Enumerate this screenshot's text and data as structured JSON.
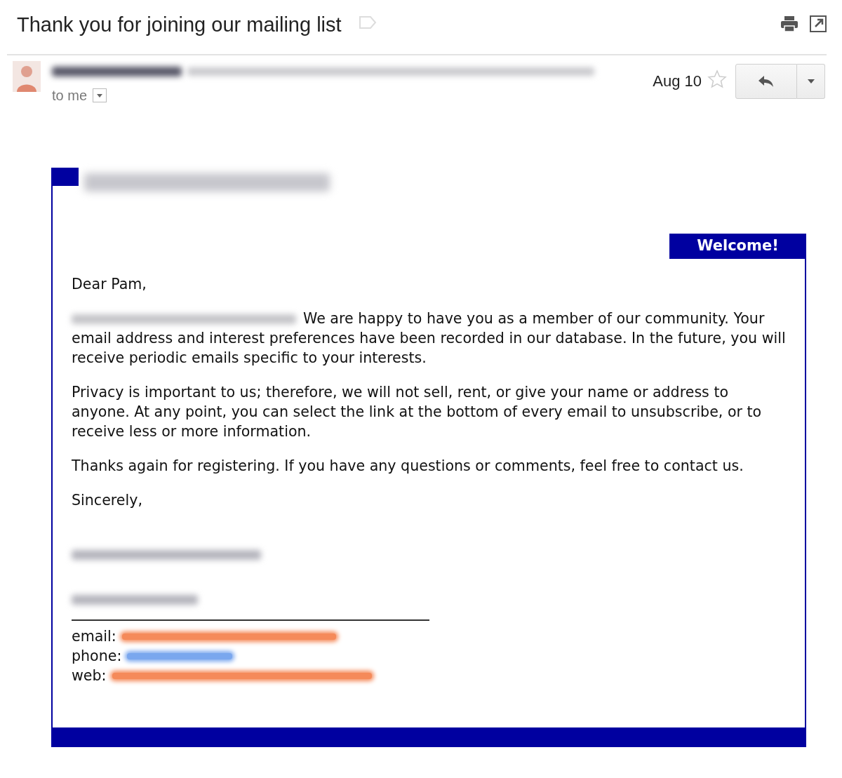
{
  "subject": "Thank you for joining our mailing list",
  "sender": {
    "recipient": "to me",
    "date": "Aug 10",
    "starred": false
  },
  "email": {
    "banner": "Welcome!",
    "greeting": "Dear Pam,",
    "paragraphs": [
      {
        "text": "We are happy to have you as a member of our community. Your email address and interest preferences have been recorded in our database. In the future, you will receive periodic emails specific to your interests.",
        "redacted_lead": true
      },
      {
        "text": "Privacy is important to us; therefore, we will not sell, rent, or give your name or address to anyone. At any point, you can select the link at the bottom of every email to unsubscribe, or to receive less or more information.",
        "redacted_lead": false
      },
      {
        "text": "Thanks again for registering. If you have any questions or comments, feel free to contact us.",
        "redacted_lead": false
      }
    ],
    "closing": "Sincerely,",
    "contacts": [
      {
        "label": "email:",
        "color": "#f58a5a"
      },
      {
        "label": "phone:",
        "color": "#7aa7ee"
      },
      {
        "label": "web:",
        "color": "#f58a5a"
      }
    ]
  }
}
